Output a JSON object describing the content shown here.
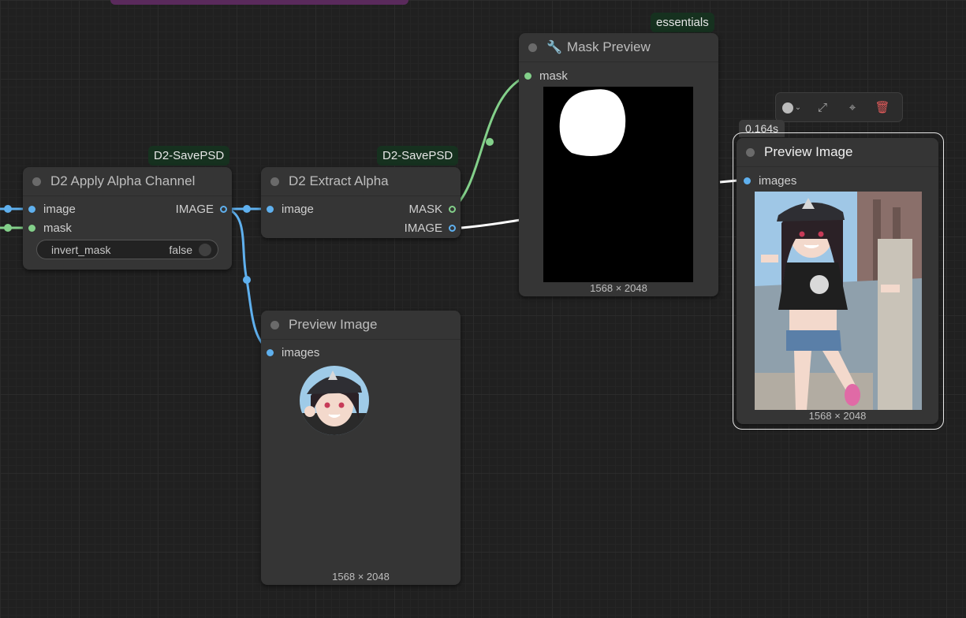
{
  "canvas": {
    "badges": {
      "apply_alpha": "D2-SavePSD",
      "extract_alpha": "D2-SavePSD",
      "mask_preview": "essentials"
    },
    "colors": {
      "image_wire": "#5fb0ee",
      "mask_wire": "#83d08a",
      "white_wire": "#ffffff",
      "toolbar_delete": "#e05a5a"
    }
  },
  "nodes": {
    "apply_alpha": {
      "title": "D2 Apply Alpha Channel",
      "inputs": [
        "image",
        "mask"
      ],
      "output": "IMAGE",
      "widget": {
        "name": "invert_mask",
        "value": "false"
      }
    },
    "extract_alpha": {
      "title": "D2 Extract Alpha",
      "input": "image",
      "outputs": [
        "MASK",
        "IMAGE"
      ]
    },
    "preview_circle": {
      "title": "Preview Image",
      "input": "images",
      "dims": "1568 × 2048"
    },
    "mask_preview": {
      "title": "Mask Preview",
      "icon": "wrench-icon",
      "input": "mask",
      "dims": "1568 × 2048"
    },
    "preview_full": {
      "title": "Preview Image",
      "input": "images",
      "dims": "1568 × 2048",
      "timing": "0.164s"
    }
  },
  "toolbar": {
    "icons": [
      "color-circle-icon",
      "bypass-icon",
      "pin-icon",
      "delete-icon"
    ]
  }
}
